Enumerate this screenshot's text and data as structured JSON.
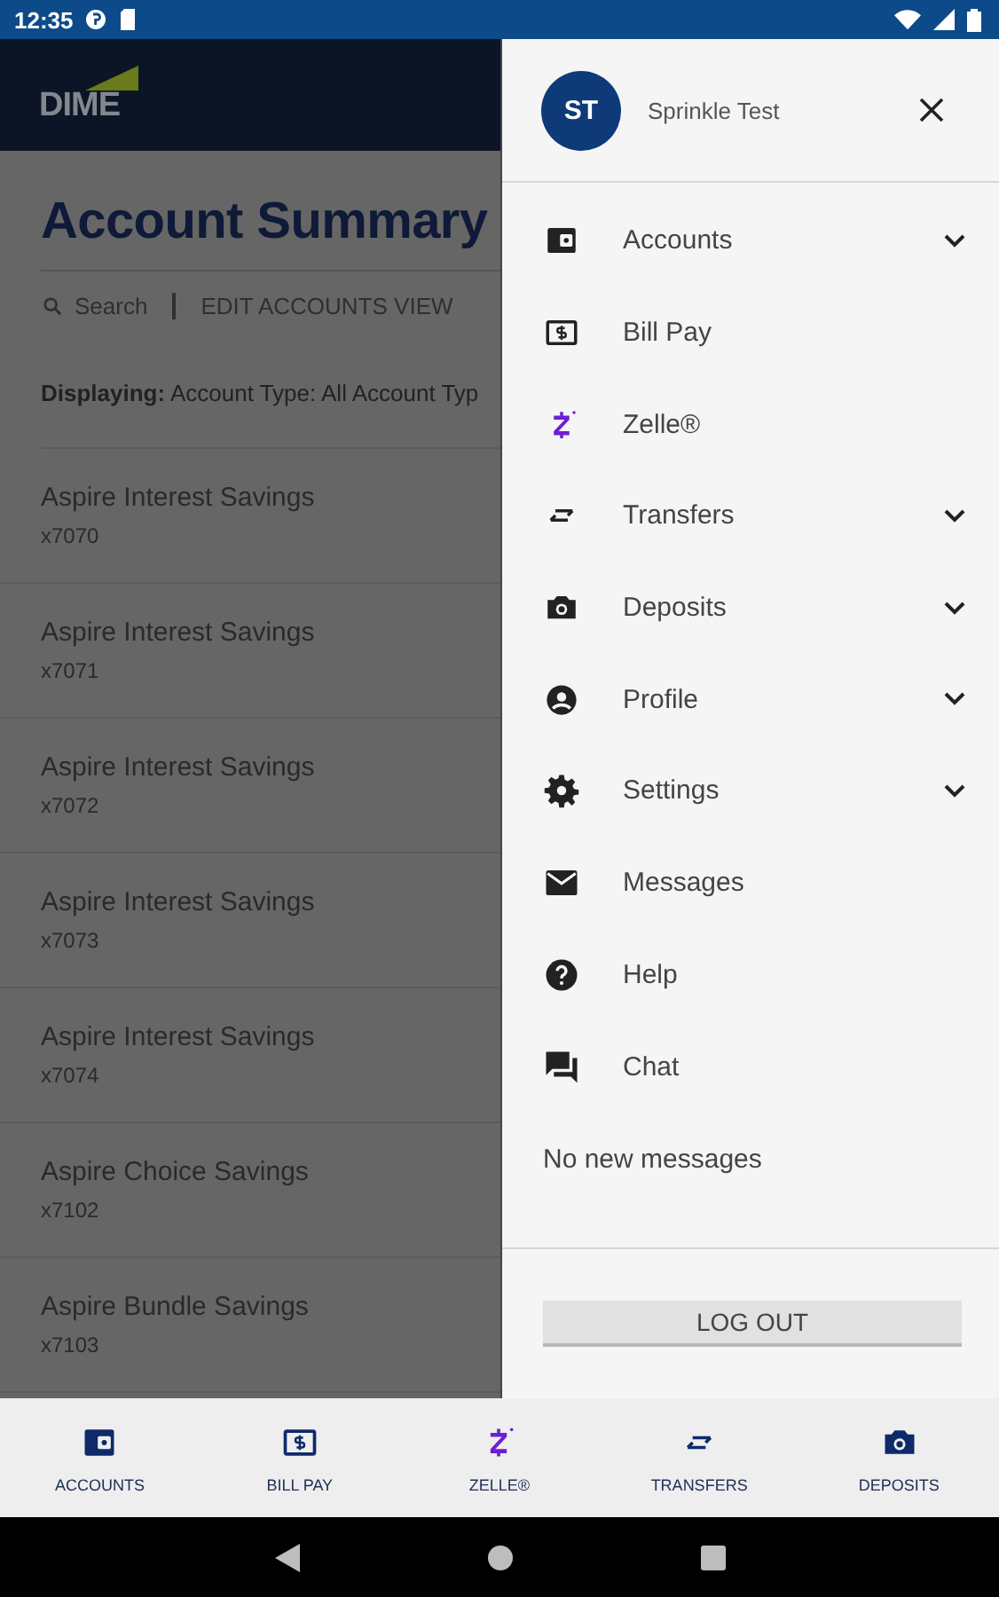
{
  "status_bar": {
    "time": "12:35"
  },
  "header": {
    "logo": "DIME"
  },
  "page": {
    "title": "Account Summary",
    "search": "Search",
    "edit": "EDIT ACCOUNTS VIEW",
    "filter": "**Displaying:** Account Type: All Account Typ"
  },
  "accounts": [
    {
      "name": "Aspire Interest Savings",
      "number": "x7070"
    },
    {
      "name": "Aspire Interest Savings",
      "number": "x7071"
    },
    {
      "name": "Aspire Interest Savings",
      "number": "x7072"
    },
    {
      "name": "Aspire Interest Savings",
      "number": "x7073"
    },
    {
      "name": "Aspire Interest Savings",
      "number": "x7074"
    },
    {
      "name": "Aspire Choice Savings",
      "number": "x7102"
    },
    {
      "name": "Aspire Bundle Savings",
      "number": "x7103"
    }
  ],
  "drawer": {
    "user": {
      "initials": "ST",
      "name": "Sprinkle Test"
    },
    "items": [
      {
        "label": "Accounts",
        "expandable": true
      },
      {
        "label": "Bill Pay",
        "expandable": false
      },
      {
        "label": "Zelle®",
        "expandable": false
      },
      {
        "label": "Transfers",
        "expandable": true
      },
      {
        "label": "Deposits",
        "expandable": true
      },
      {
        "label": "Profile",
        "expandable": true
      },
      {
        "label": "Settings",
        "expandable": true
      },
      {
        "label": "Messages",
        "expandable": false
      },
      {
        "label": "Help",
        "expandable": false
      },
      {
        "label": "Chat",
        "expandable": false
      }
    ],
    "note": "No new messages",
    "logout": "LOG OUT"
  },
  "bottom_nav": [
    {
      "label": "ACCOUNTS"
    },
    {
      "label": "BILL PAY"
    },
    {
      "label": "ZELLE®"
    },
    {
      "label": "TRANSFERS"
    },
    {
      "label": "DEPOSITS"
    }
  ]
}
